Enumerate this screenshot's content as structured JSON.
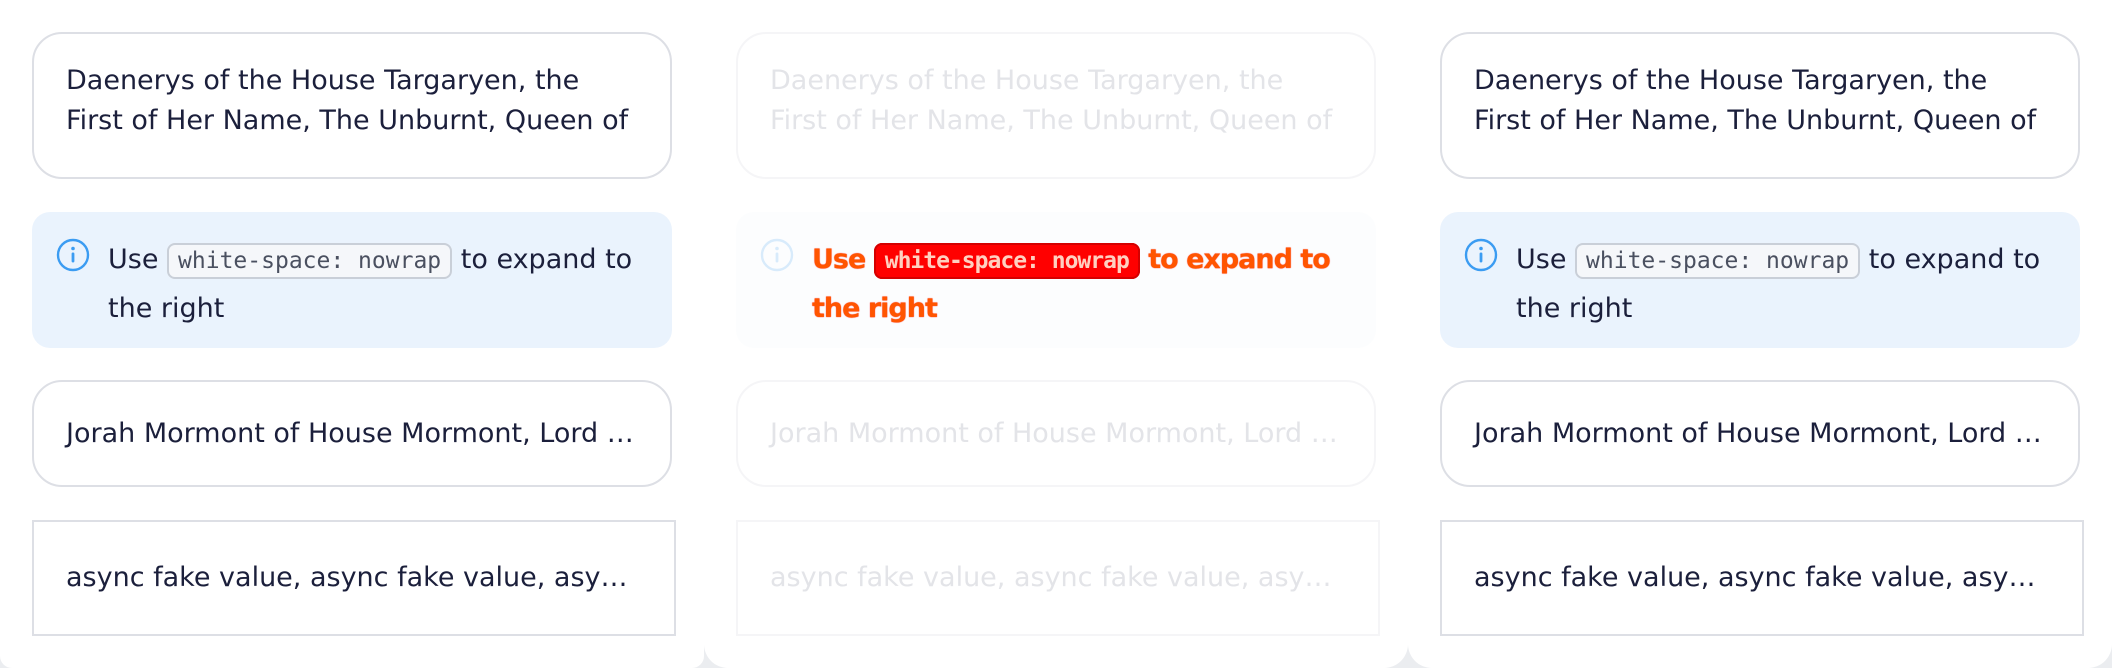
{
  "multiline_field": {
    "value": "Daenerys of the House Targaryen, the First of Her Name, The Unburnt, Queen of the Andal…"
  },
  "notice": {
    "prefix": "Use",
    "code": "white-space: nowrap",
    "suffix": "to expand to the right",
    "icon": "info-icon"
  },
  "single_field": {
    "value": "Jorah Mormont of House Mormont, Lord of B…"
  },
  "async_box": {
    "value": "async fake value, async fake value, async fak…"
  },
  "colors": {
    "accent": "#3b9cf2",
    "notice_bg": "#eaf3fd",
    "text": "#1b1f3b",
    "border": "#dddfe5"
  }
}
